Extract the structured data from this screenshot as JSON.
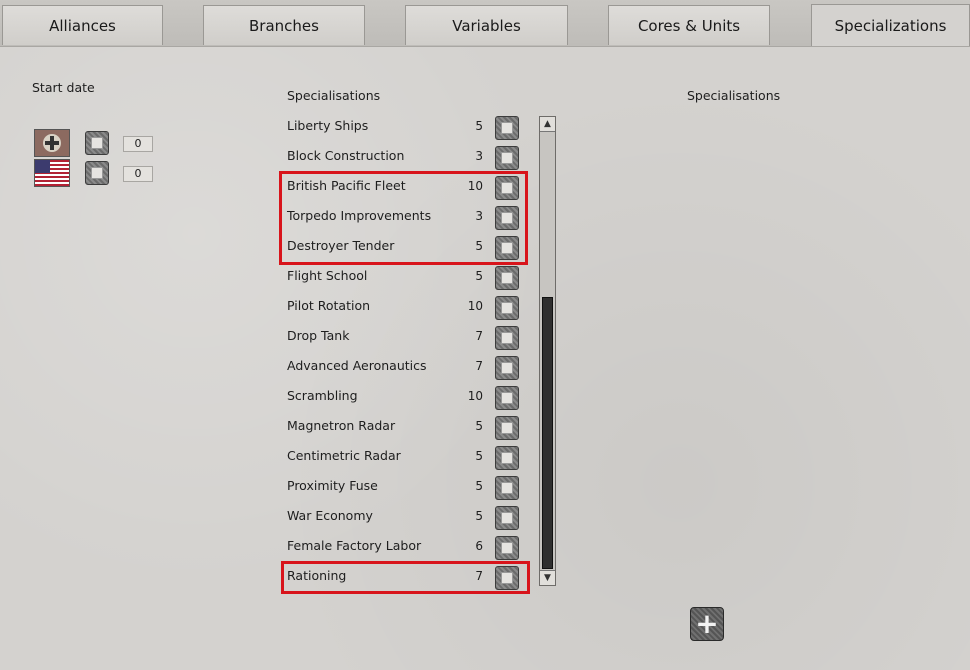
{
  "tabs": [
    {
      "label": "Alliances",
      "active": false
    },
    {
      "label": "Branches",
      "active": false
    },
    {
      "label": "Variables",
      "active": false
    },
    {
      "label": "Cores & Units",
      "active": false
    },
    {
      "label": "Specializations",
      "active": true
    }
  ],
  "left": {
    "start_date_label": "Start date",
    "factions": [
      {
        "flag": "german-flag-icon",
        "value": "0"
      },
      {
        "flag": "usa-flag-icon",
        "value": "0"
      }
    ]
  },
  "middle": {
    "header": "Specialisations",
    "items": [
      {
        "name": "Liberty Ships",
        "cost": "5"
      },
      {
        "name": "Block Construction",
        "cost": "3"
      },
      {
        "name": "British Pacific Fleet",
        "cost": "10"
      },
      {
        "name": "Torpedo Improvements",
        "cost": "3"
      },
      {
        "name": "Destroyer Tender",
        "cost": "5"
      },
      {
        "name": "Flight School",
        "cost": "5"
      },
      {
        "name": "Pilot Rotation",
        "cost": "10"
      },
      {
        "name": "Drop Tank",
        "cost": "7"
      },
      {
        "name": "Advanced Aeronautics",
        "cost": "7"
      },
      {
        "name": "Scrambling",
        "cost": "10"
      },
      {
        "name": "Magnetron Radar",
        "cost": "5"
      },
      {
        "name": "Centimetric Radar",
        "cost": "5"
      },
      {
        "name": "Proximity Fuse",
        "cost": "5"
      },
      {
        "name": "War Economy",
        "cost": "5"
      },
      {
        "name": "Female Factory Labor",
        "cost": "6"
      },
      {
        "name": "Rationing",
        "cost": "7"
      }
    ]
  },
  "right": {
    "header": "Specialisations",
    "add_icon": "plus-icon"
  },
  "colors": {
    "highlight": "#d8141b"
  }
}
